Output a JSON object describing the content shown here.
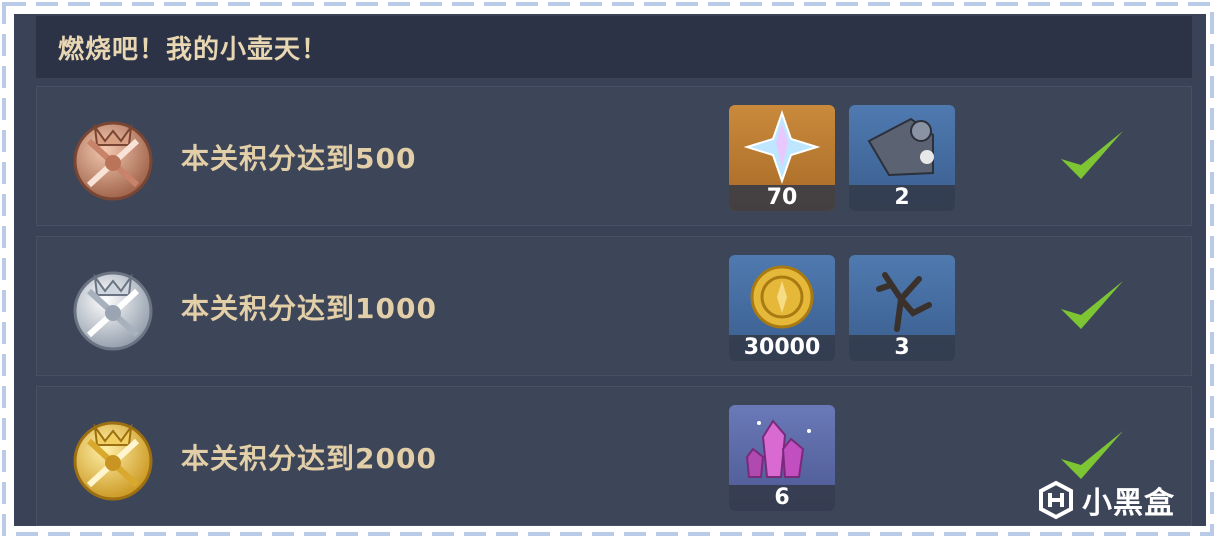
{
  "panel": {
    "title": "燃烧吧！我的小壶天！"
  },
  "rows": [
    {
      "label": "本关积分达到500",
      "medal": "bronze-medal-icon",
      "completed": true,
      "rewards": [
        {
          "icon": "primogem-icon",
          "count": "70"
        },
        {
          "icon": "scroll-material-icon",
          "count": "2"
        }
      ]
    },
    {
      "label": "本关积分达到1000",
      "medal": "silver-medal-icon",
      "completed": true,
      "rewards": [
        {
          "icon": "mora-coin-icon",
          "count": "30000"
        },
        {
          "icon": "branch-material-icon",
          "count": "3"
        }
      ]
    },
    {
      "label": "本关积分达到2000",
      "medal": "gold-medal-icon",
      "completed": true,
      "rewards": [
        {
          "icon": "crystal-ore-icon",
          "count": "6"
        }
      ]
    }
  ],
  "watermark": {
    "text": "小黑盒"
  },
  "colors": {
    "panel_bg": "#3a4257",
    "header_bg": "#2c3346",
    "title_text": "#e8d7b2",
    "check_green": "#7ec534",
    "frame_dash": "#b9cbe6"
  }
}
